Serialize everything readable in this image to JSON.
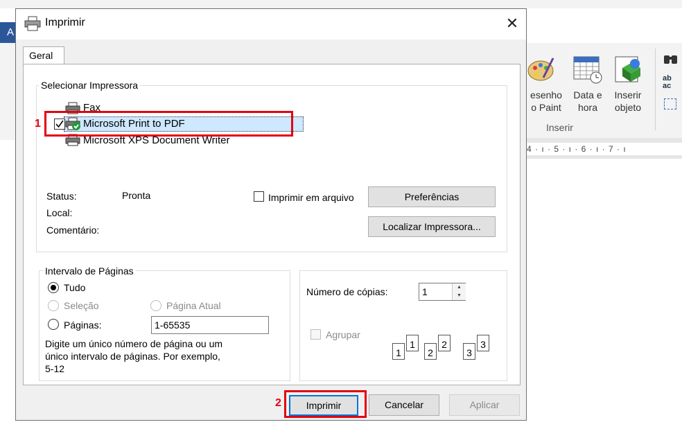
{
  "background": {
    "left_tab_letter": "A",
    "ribbon": {
      "buttons": [
        {
          "label1": "esenho",
          "label2": "o Paint"
        },
        {
          "label1": "Data e",
          "label2": "hora"
        },
        {
          "label1": "Inserir",
          "label2": "objeto"
        }
      ],
      "group_label": "Inserir",
      "small_icon_text": "ab ac"
    },
    "ruler_text": "4 · ı · 5 · ı · 6 · ı · 7 · ı"
  },
  "dialog": {
    "title": "Imprimir",
    "close_glyph": "✕",
    "tab_label": "Geral",
    "select_printer": {
      "label": "Selecionar Impressora",
      "printers": [
        "Fax",
        "Microsoft Print to PDF",
        "Microsoft XPS Document Writer"
      ],
      "selected_index": 1
    },
    "status": {
      "status_label": "Status:",
      "status_value": "Pronta",
      "local_label": "Local:",
      "comment_label": "Comentário:"
    },
    "print_to_file_label": "Imprimir em arquivo",
    "preferences_button": "Preferências",
    "find_printer_button": "Localizar Impressora...",
    "page_range": {
      "label": "Intervalo de Páginas",
      "all_label": "Tudo",
      "selection_label": "Seleção",
      "current_page_label": "Página Atual",
      "pages_label": "Páginas:",
      "pages_value": "1-65535",
      "help_text_1": "Digite um único número de página ou um",
      "help_text_2": "único intervalo de páginas. Por exemplo,",
      "help_text_3": "5-12"
    },
    "copies": {
      "label": "Número de cópias:",
      "value": "1",
      "collate_label": "Agrupar",
      "collate_icons": [
        "1",
        "1",
        "2",
        "2",
        "3",
        "3"
      ]
    },
    "buttons": {
      "print": "Imprimir",
      "cancel": "Cancelar",
      "apply": "Aplicar"
    },
    "annotations": {
      "step1": "1",
      "step2": "2"
    }
  },
  "colors": {
    "highlight_red": "#e3000f",
    "selection_blue": "#cde8ff",
    "word_blue": "#2b579a",
    "default_button_border": "#0078d7"
  }
}
